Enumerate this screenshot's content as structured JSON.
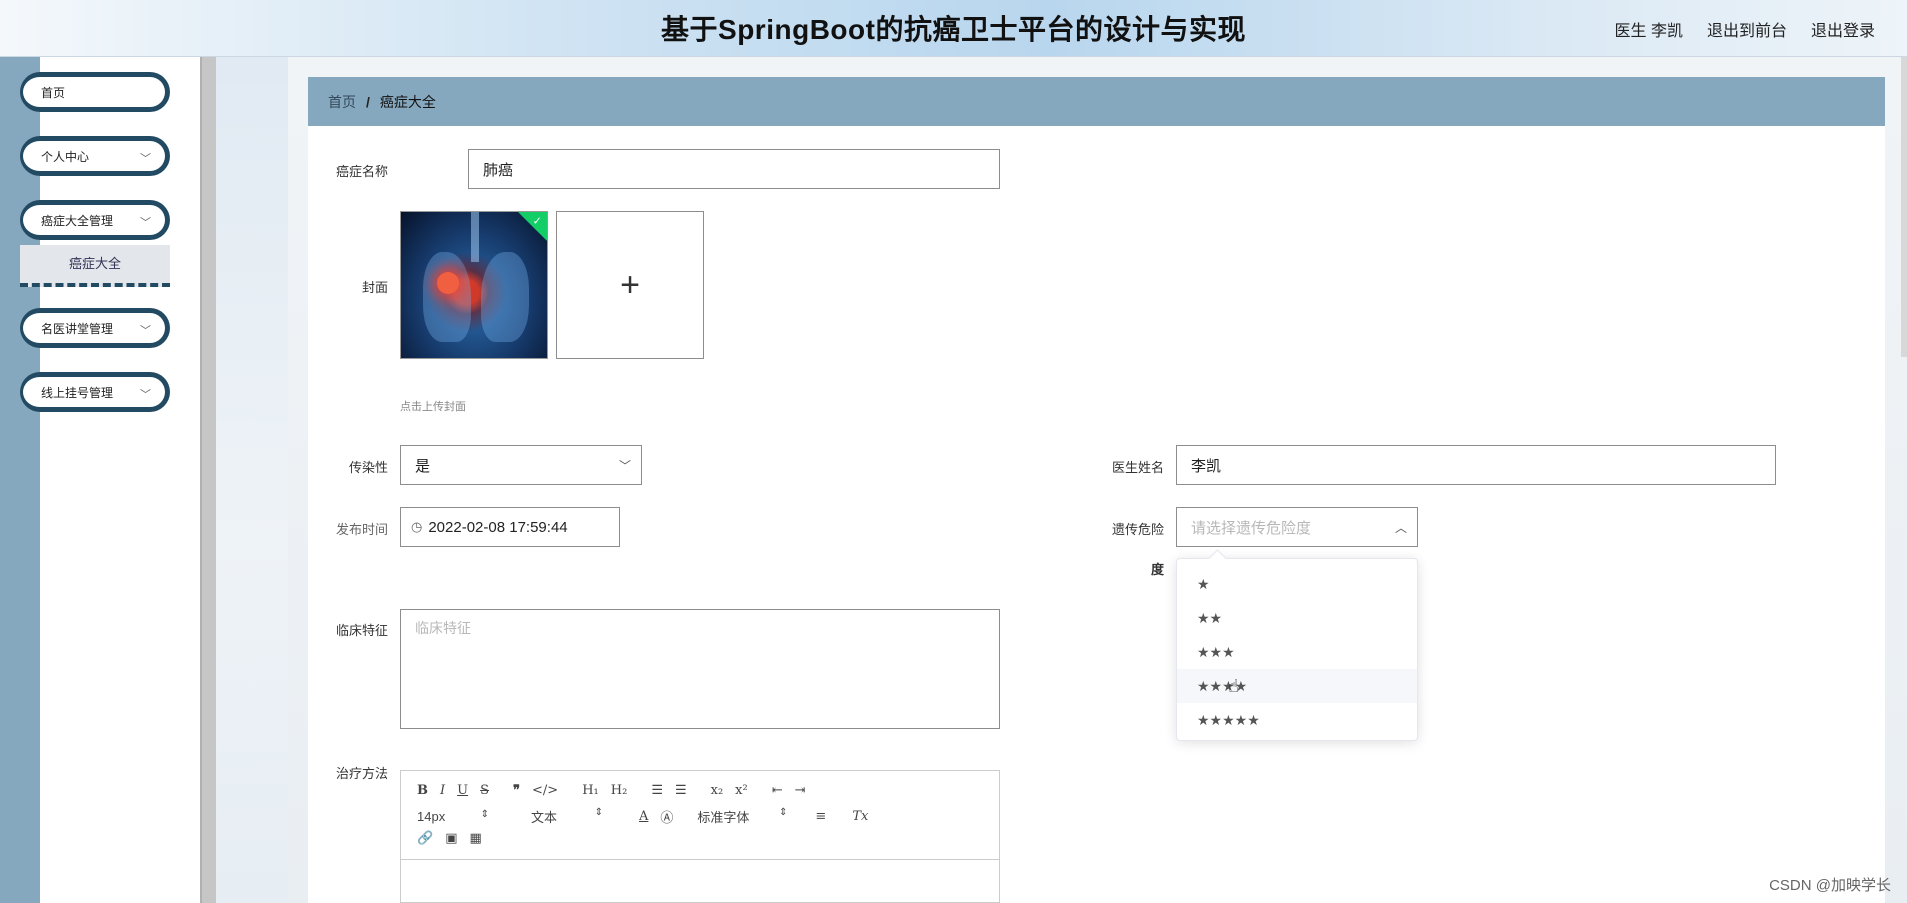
{
  "header": {
    "title": "基于SpringBoot的抗癌卫士平台的设计与实现",
    "user": "医生 李凯",
    "front_link": "退出到前台",
    "logout": "退出登录"
  },
  "sidebar": {
    "items": [
      {
        "label": "首页"
      },
      {
        "label": "个人中心"
      },
      {
        "label": "癌症大全管理"
      },
      {
        "label": "名医讲堂管理"
      },
      {
        "label": "线上挂号管理"
      }
    ],
    "submenu": "癌症大全"
  },
  "breadcrumb": {
    "home": "首页",
    "separator": "/",
    "current": "癌症大全"
  },
  "form": {
    "name_label": "癌症名称",
    "name_value": "肺癌",
    "cover_label": "封面",
    "upload_add": "+",
    "cover_hint": "点击上传封面",
    "contagious_label": "传染性",
    "contagious_value": "是",
    "doctor_label": "医生姓名",
    "doctor_value": "李凯",
    "publish_label": "发布时间",
    "publish_value": "2022-02-08 17:59:44",
    "risk_label_1": "遗传危险",
    "risk_label_2": "度",
    "risk_placeholder": "请选择遗传危险度",
    "risk_options": [
      "★",
      "★★",
      "★★★",
      "★★★★",
      "★★★★★"
    ],
    "clinical_label": "临床特征",
    "clinical_placeholder": "临床特征",
    "treatment_label": "治疗方法"
  },
  "editor": {
    "font_size": "14px",
    "text_type": "文本",
    "font_family": "标准字体"
  },
  "watermark": "CSDN @加映学长"
}
